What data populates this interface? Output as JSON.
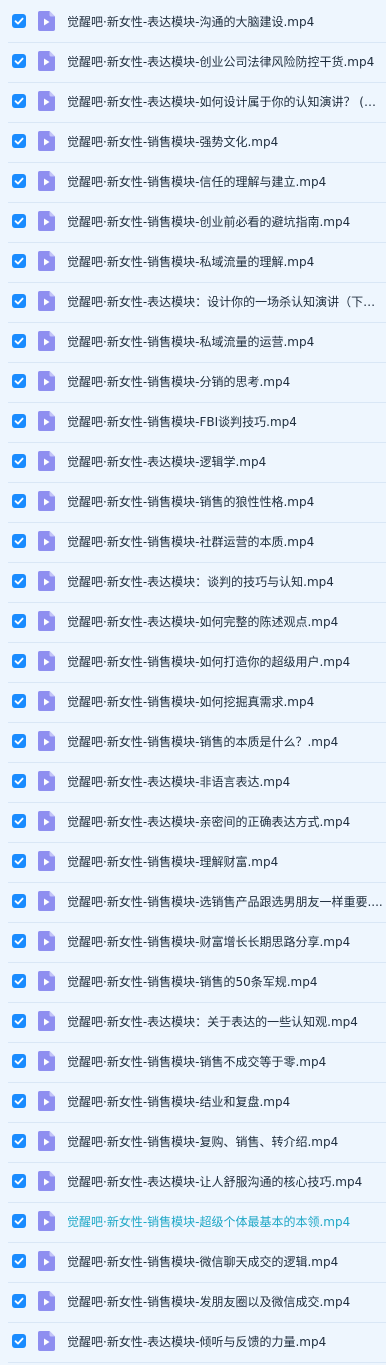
{
  "colors": {
    "background": "#eef6fe",
    "checkbox": "#1a8cff",
    "file_icon": "#8e8ef0",
    "text": "#1f2d3d",
    "highlight_text": "#1fa7c6"
  },
  "icons": {
    "checkbox": "checkbox-checked-icon",
    "file": "video-file-icon"
  },
  "files": [
    {
      "name": "觉醒吧·新女性-表达模块-沟通的大脑建设.mp4",
      "checked": true,
      "highlight": false
    },
    {
      "name": "觉醒吧·新女性-表达模块-创业公司法律风险防控干货.mp4",
      "checked": true,
      "highlight": false
    },
    {
      "name": "觉醒吧·新女性-表达模块-如何设计属于你的认知演讲？ (…",
      "checked": true,
      "highlight": false
    },
    {
      "name": "觉醒吧·新女性-销售模块-强势文化.mp4",
      "checked": true,
      "highlight": false
    },
    {
      "name": "觉醒吧·新女性-销售模块-信任的理解与建立.mp4",
      "checked": true,
      "highlight": false
    },
    {
      "name": "觉醒吧·新女性-销售模块-创业前必看的避坑指南.mp4",
      "checked": true,
      "highlight": false
    },
    {
      "name": "觉醒吧·新女性-销售模块-私域流量的理解.mp4",
      "checked": true,
      "highlight": false
    },
    {
      "name": "觉醒吧·新女性-表达模块：设计你的一场杀认知演讲（下…",
      "checked": true,
      "highlight": false
    },
    {
      "name": "觉醒吧·新女性-销售模块-私域流量的运营.mp4",
      "checked": true,
      "highlight": false
    },
    {
      "name": "觉醒吧·新女性-销售模块-分销的思考.mp4",
      "checked": true,
      "highlight": false
    },
    {
      "name": "觉醒吧·新女性-销售模块-FBI谈判技巧.mp4",
      "checked": true,
      "highlight": false
    },
    {
      "name": "觉醒吧·新女性-表达模块-逻辑学.mp4",
      "checked": true,
      "highlight": false
    },
    {
      "name": "觉醒吧·新女性-销售模块-销售的狼性性格.mp4",
      "checked": true,
      "highlight": false
    },
    {
      "name": "觉醒吧·新女性-销售模块-社群运营的本质.mp4",
      "checked": true,
      "highlight": false
    },
    {
      "name": "觉醒吧·新女性-表达模块：谈判的技巧与认知.mp4",
      "checked": true,
      "highlight": false
    },
    {
      "name": "觉醒吧·新女性-表达模块-如何完整的陈述观点.mp4",
      "checked": true,
      "highlight": false
    },
    {
      "name": "觉醒吧·新女性-销售模块-如何打造你的超级用户.mp4",
      "checked": true,
      "highlight": false
    },
    {
      "name": "觉醒吧·新女性-销售模块-如何挖掘真需求.mp4",
      "checked": true,
      "highlight": false
    },
    {
      "name": "觉醒吧·新女性-销售模块-销售的本质是什么？.mp4",
      "checked": true,
      "highlight": false
    },
    {
      "name": "觉醒吧·新女性-表达模块-非语言表达.mp4",
      "checked": true,
      "highlight": false
    },
    {
      "name": "觉醒吧·新女性-表达模块-亲密间的正确表达方式.mp4",
      "checked": true,
      "highlight": false
    },
    {
      "name": "觉醒吧·新女性-销售模块-理解财富.mp4",
      "checked": true,
      "highlight": false
    },
    {
      "name": "觉醒吧·新女性-销售模块-选销售产品跟选男朋友一样重要....",
      "checked": true,
      "highlight": false
    },
    {
      "name": "觉醒吧·新女性-销售模块-财富增长长期思路分享.mp4",
      "checked": true,
      "highlight": false
    },
    {
      "name": "觉醒吧·新女性-销售模块-销售的50条军规.mp4",
      "checked": true,
      "highlight": false
    },
    {
      "name": "觉醒吧·新女性-表达模块：关于表达的一些认知观.mp4",
      "checked": true,
      "highlight": false
    },
    {
      "name": "觉醒吧·新女性-销售模块-销售不成交等于零.mp4",
      "checked": true,
      "highlight": false
    },
    {
      "name": "觉醒吧·新女性-销售模块-结业和复盘.mp4",
      "checked": true,
      "highlight": false
    },
    {
      "name": "觉醒吧·新女性-销售模块-复购、销售、转介绍.mp4",
      "checked": true,
      "highlight": false
    },
    {
      "name": "觉醒吧·新女性-表达模块-让人舒服沟通的核心技巧.mp4",
      "checked": true,
      "highlight": false
    },
    {
      "name": "觉醒吧·新女性-销售模块-超级个体最基本的本领.mp4",
      "checked": true,
      "highlight": true
    },
    {
      "name": "觉醒吧·新女性-销售模块-微信聊天成交的逻辑.mp4",
      "checked": true,
      "highlight": false
    },
    {
      "name": "觉醒吧·新女性-销售模块-发朋友圈以及微信成交.mp4",
      "checked": true,
      "highlight": false
    },
    {
      "name": "觉醒吧·新女性-表达模块-倾听与反馈的力量.mp4",
      "checked": true,
      "highlight": false
    }
  ]
}
